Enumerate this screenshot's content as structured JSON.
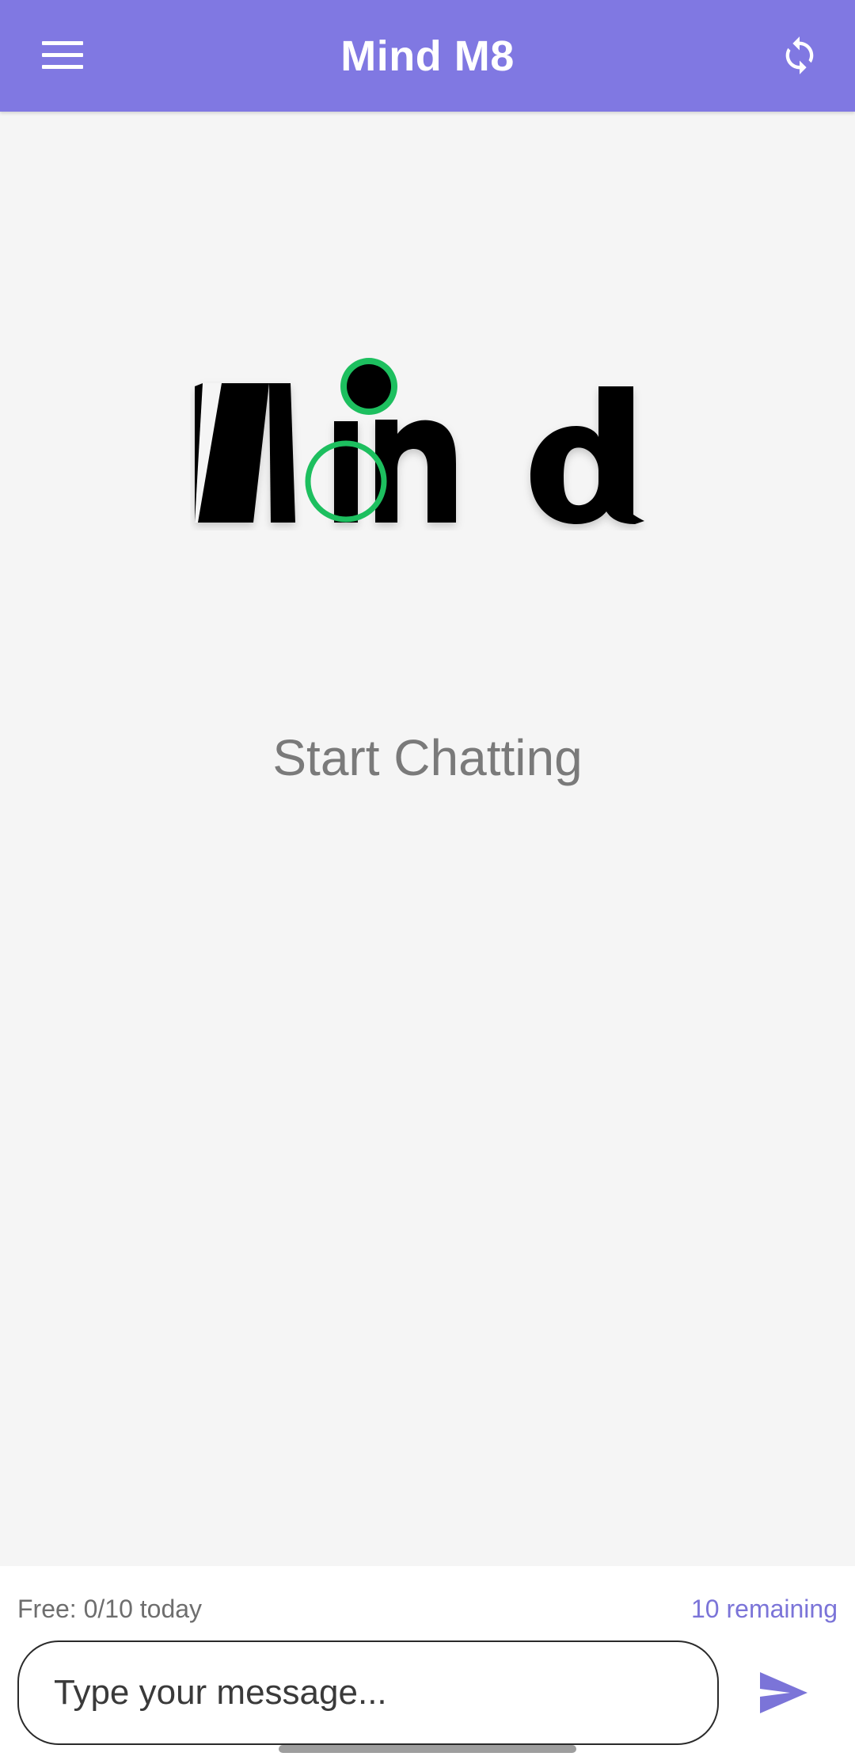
{
  "app_bar": {
    "title": "Mind M8",
    "background_color": "#8078e2",
    "menu_icon": "hamburger-menu-icon",
    "refresh_icon": "refresh-icon"
  },
  "logo": {
    "text": "Mind",
    "accent_color": "#1dbf5f"
  },
  "main": {
    "empty_state_text": "Start Chatting"
  },
  "footer": {
    "usage_label": "Free: 0/10 today",
    "remaining_label": "10 remaining",
    "input": {
      "value": "",
      "placeholder": "Type your message..."
    },
    "send_icon": "send-icon",
    "accent_color": "#7b74d8"
  }
}
